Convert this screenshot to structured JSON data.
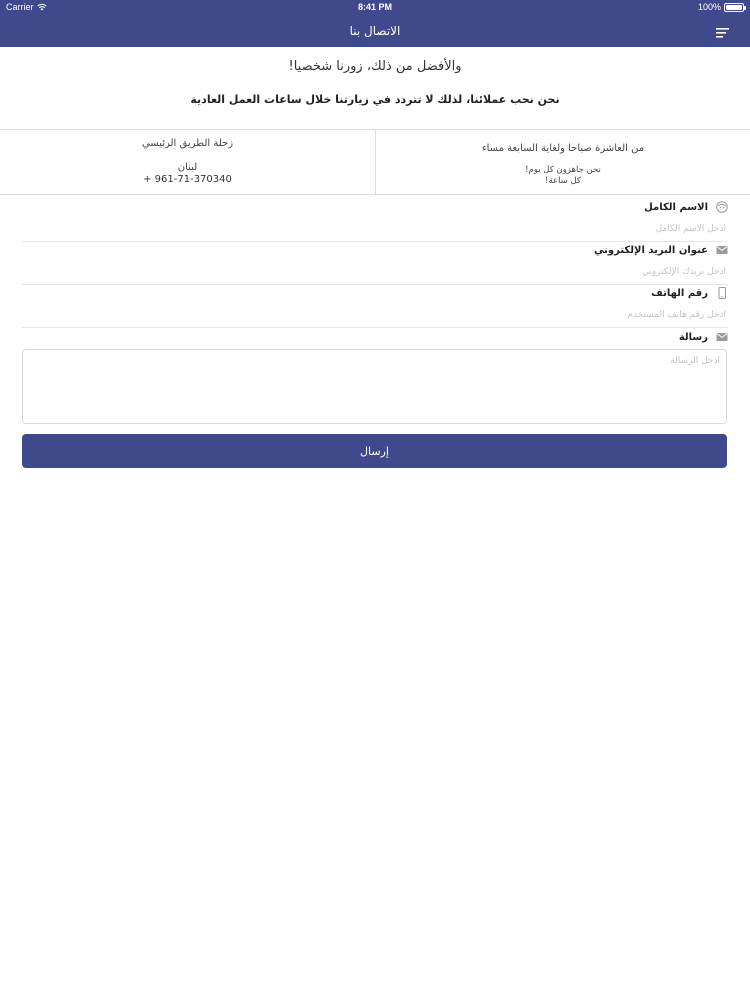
{
  "status_bar": {
    "carrier": "Carrier",
    "time": "8:41 PM",
    "battery": "100%",
    "battery_level": 1.0
  },
  "nav": {
    "title": "الاتصال بنا",
    "menu_icon": "menu-icon"
  },
  "intro": {
    "headline": "والأفضل من ذلك، زورنا شخصيا!",
    "subtext": "نحن نحب عملائنا، لذلك لا تتردد في زيارتنا خلال ساعات العمل العادية"
  },
  "info": {
    "location": {
      "street": "زحلة الطريق الرئيسي",
      "country": "لبنان",
      "phone": "+ 961-71-370340"
    },
    "hours": {
      "hours": "من العاشرة صباحا ولغاية السابعة مساء",
      "ready": "نحن جاهزون كل يوم!",
      "every_hour": "كل ساعة!"
    }
  },
  "form": {
    "name": {
      "label": "الاسم الكامل",
      "placeholder": "ادخل الاسم الكامل",
      "icon": "person-face-icon"
    },
    "email": {
      "label": "عنوان البريد الإلكتروني",
      "placeholder": "ادخل بريدك الإلكتروني",
      "icon": "envelope-icon"
    },
    "phone": {
      "label": "رقم الهاتف",
      "placeholder": "ادخل رقم هاتف المستخدم",
      "icon": "mobile-phone-icon"
    },
    "message": {
      "label": "رسالة",
      "placeholder": "ادخل الرسالة",
      "icon": "envelope-icon"
    },
    "submit_label": "إرسال"
  },
  "colors": {
    "primary": "#3f4a8c",
    "divider": "#dddddd",
    "placeholder": "#c4c4c4"
  }
}
